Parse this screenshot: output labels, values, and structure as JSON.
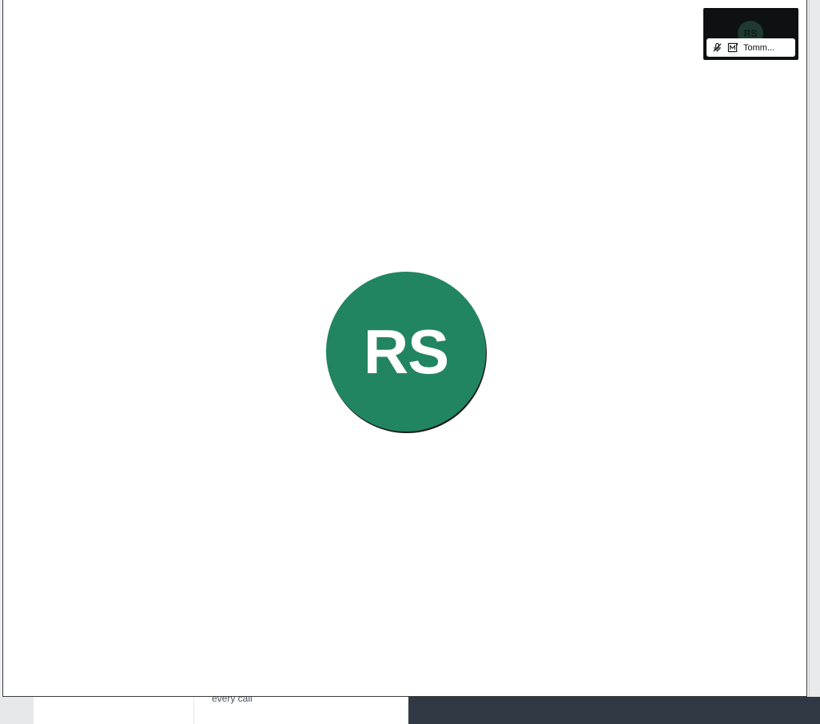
{
  "call": {
    "remote_participant": {
      "initials": "RS",
      "avatar_color": "#228561"
    },
    "self_view": {
      "initials": "RS",
      "name": "Tomm...",
      "mic_state": "muted",
      "icons": [
        "mic-off-icon",
        "screen-share-icon"
      ]
    }
  },
  "background_app": {
    "partial_text": "every call",
    "dark_panel_color": "#303844"
  }
}
